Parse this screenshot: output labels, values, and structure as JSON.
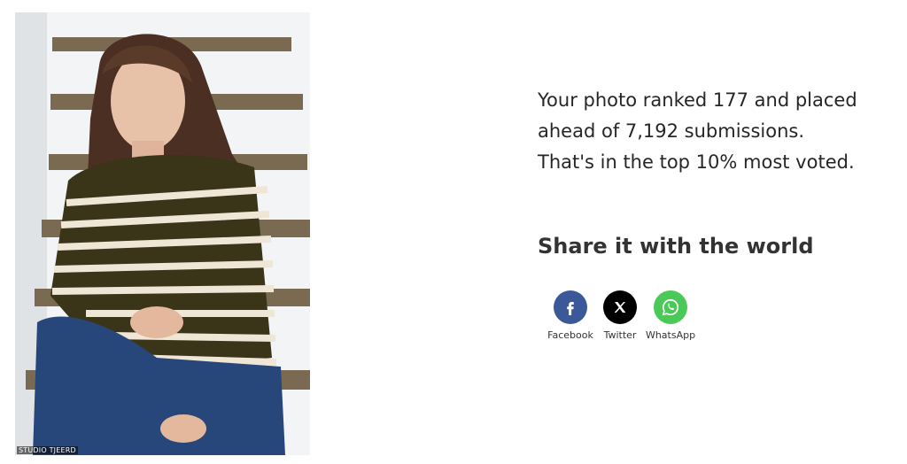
{
  "photo": {
    "alt": "Girl in striped sweater sitting on stairs",
    "watermark": "STUDIO TJEERD"
  },
  "result": {
    "line1": "Your photo ranked 177 and placed",
    "line2": "ahead of 7,192 submissions.",
    "line3": "That's in the top 10% most voted."
  },
  "share": {
    "heading": "Share it with the world",
    "buttons": [
      {
        "label": "Facebook",
        "icon": "facebook-icon",
        "color": "#3b5998"
      },
      {
        "label": "Twitter",
        "icon": "x-twitter-icon",
        "color": "#000000"
      },
      {
        "label": "WhatsApp",
        "icon": "whatsapp-icon",
        "color": "#4ac959"
      }
    ]
  }
}
